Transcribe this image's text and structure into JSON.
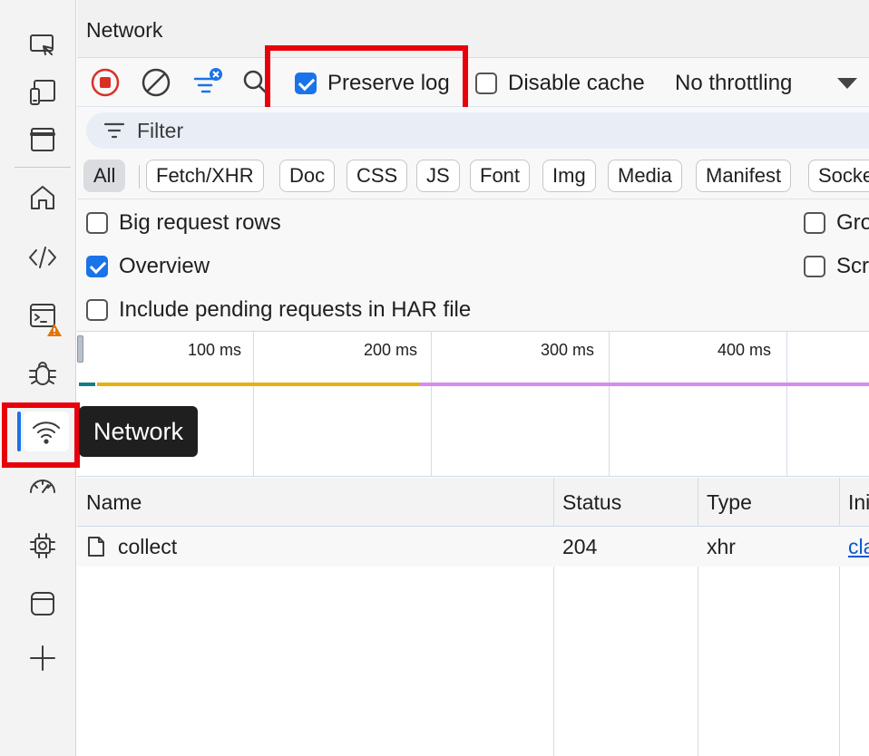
{
  "panel": {
    "title": "Network"
  },
  "tooltip": {
    "text": "Network"
  },
  "activity_icons": [
    "inspect-icon",
    "device-icon",
    "window-icon",
    "home-icon",
    "code-icon",
    "console-icon",
    "bug-icon",
    "wifi-icon",
    "performance-icon",
    "chip-icon",
    "panel-icon",
    "plus-icon"
  ],
  "toolbar": {
    "preserve_log": "Preserve log",
    "disable_cache": "Disable cache",
    "throttling": "No throttling"
  },
  "filter": {
    "placeholder": "Filter"
  },
  "types": [
    "All",
    "Fetch/XHR",
    "Doc",
    "CSS",
    "JS",
    "Font",
    "Img",
    "Media",
    "Manifest",
    "Socke"
  ],
  "options": {
    "big_rows": "Big request rows",
    "overview": "Overview",
    "pending_har": "Include pending requests in HAR file",
    "group_trunc": "Gro",
    "screenshots_trunc": "Scr"
  },
  "timeline": {
    "ticks": [
      "100 ms",
      "200 ms",
      "300 ms",
      "400 ms"
    ]
  },
  "table": {
    "columns": [
      "Name",
      "Status",
      "Type",
      "Ini"
    ],
    "rows": [
      {
        "name": "collect",
        "status": "204",
        "type": "xhr",
        "initiator": "cla"
      }
    ]
  },
  "colors": {
    "accent": "#1a73e8",
    "highlight": "#e8000b",
    "record": "#d93025"
  }
}
